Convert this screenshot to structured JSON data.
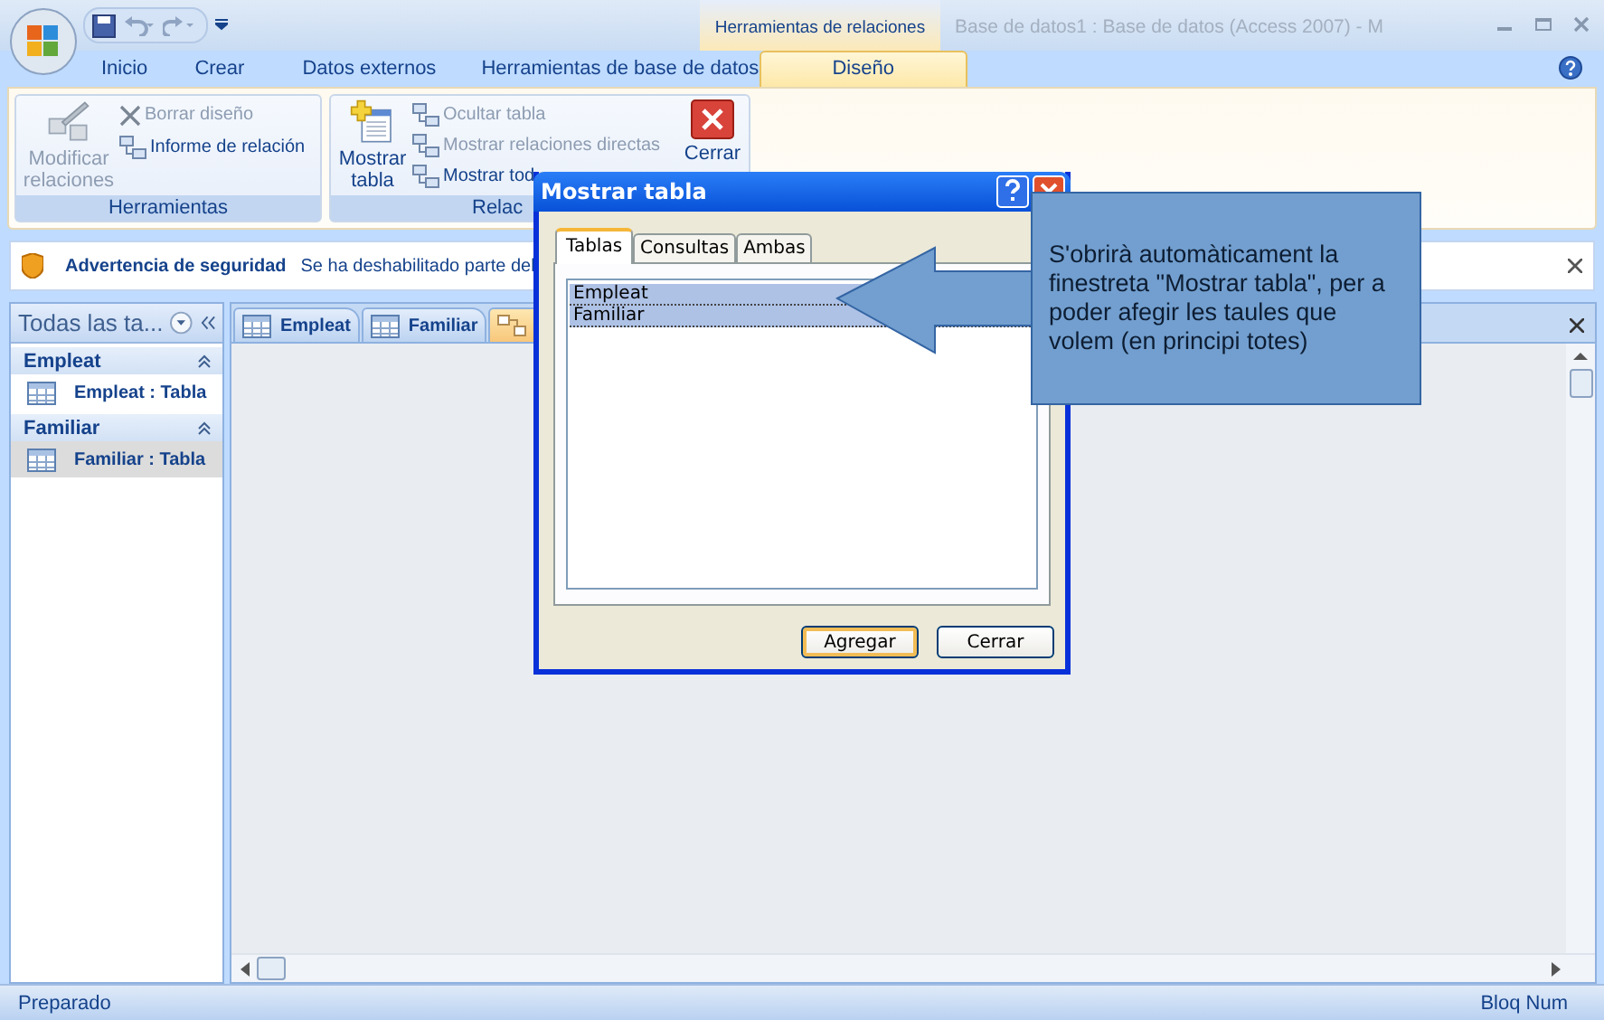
{
  "window": {
    "title": "Base de datos1 : Base de datos (Access 2007) - M",
    "contextual_tab": "Herramientas de relaciones"
  },
  "ribbon_tabs": [
    {
      "label": "Inicio",
      "selected": false
    },
    {
      "label": "Crear",
      "selected": false
    },
    {
      "label": "Datos externos",
      "selected": false
    },
    {
      "label": "Herramientas de base de datos",
      "selected": false
    },
    {
      "label": "Diseño",
      "selected": true
    }
  ],
  "ribbon_groups": [
    {
      "label": "Herramientas",
      "columns": [
        {
          "kind": "large",
          "label": "Modificar relaciones",
          "disabled": true
        },
        {
          "kind": "stack",
          "items": [
            {
              "label": "Borrar diseño",
              "disabled": true
            },
            {
              "label": "Informe de relación",
              "disabled": false
            }
          ]
        }
      ]
    },
    {
      "label": "Relac",
      "columns": [
        {
          "kind": "large",
          "label": "Mostrar tabla",
          "disabled": false
        },
        {
          "kind": "stack",
          "items": [
            {
              "label": "Ocultar tabla",
              "disabled": true
            },
            {
              "label": "Mostrar relaciones directas",
              "disabled": true
            },
            {
              "label": "Mostrar tod",
              "disabled": false
            }
          ]
        },
        {
          "kind": "large",
          "label": "Cerrar",
          "disabled": false
        }
      ]
    }
  ],
  "security_bar": {
    "title": "Advertencia de seguridad",
    "message": "Se ha deshabilitado parte del"
  },
  "navigation_pane": {
    "header": "Todas las ta...",
    "groups": [
      {
        "label": "Empleat",
        "expanded": true,
        "items": [
          {
            "label": "Empleat : Tabla",
            "selected": false
          }
        ]
      },
      {
        "label": "Familiar",
        "expanded": true,
        "items": [
          {
            "label": "Familiar : Tabla",
            "selected": true
          }
        ]
      }
    ]
  },
  "document_tabs": [
    {
      "kind": "table",
      "label": "Empleat",
      "selected": false
    },
    {
      "kind": "table",
      "label": "Familiar",
      "selected": false
    },
    {
      "kind": "relationships",
      "selected": true
    }
  ],
  "dialog": {
    "title": "Mostrar tabla",
    "tabs": [
      {
        "label": "Tablas",
        "selected": true
      },
      {
        "label": "Consultas",
        "selected": false
      },
      {
        "label": "Ambas",
        "selected": false
      }
    ],
    "list": [
      {
        "label": "Empleat",
        "selected": true
      },
      {
        "label": "Familiar",
        "selected": true
      }
    ],
    "buttons": [
      {
        "label": "Agregar",
        "default": true
      },
      {
        "label": "Cerrar",
        "default": false
      }
    ]
  },
  "callout": {
    "text": "S'obrirà automàticament la finestreta \"Mostrar tabla\", per a poder afegir les taules que volem (en principi totes)"
  },
  "status_bar": {
    "left": "Preparado",
    "right": "Bloq Num"
  }
}
